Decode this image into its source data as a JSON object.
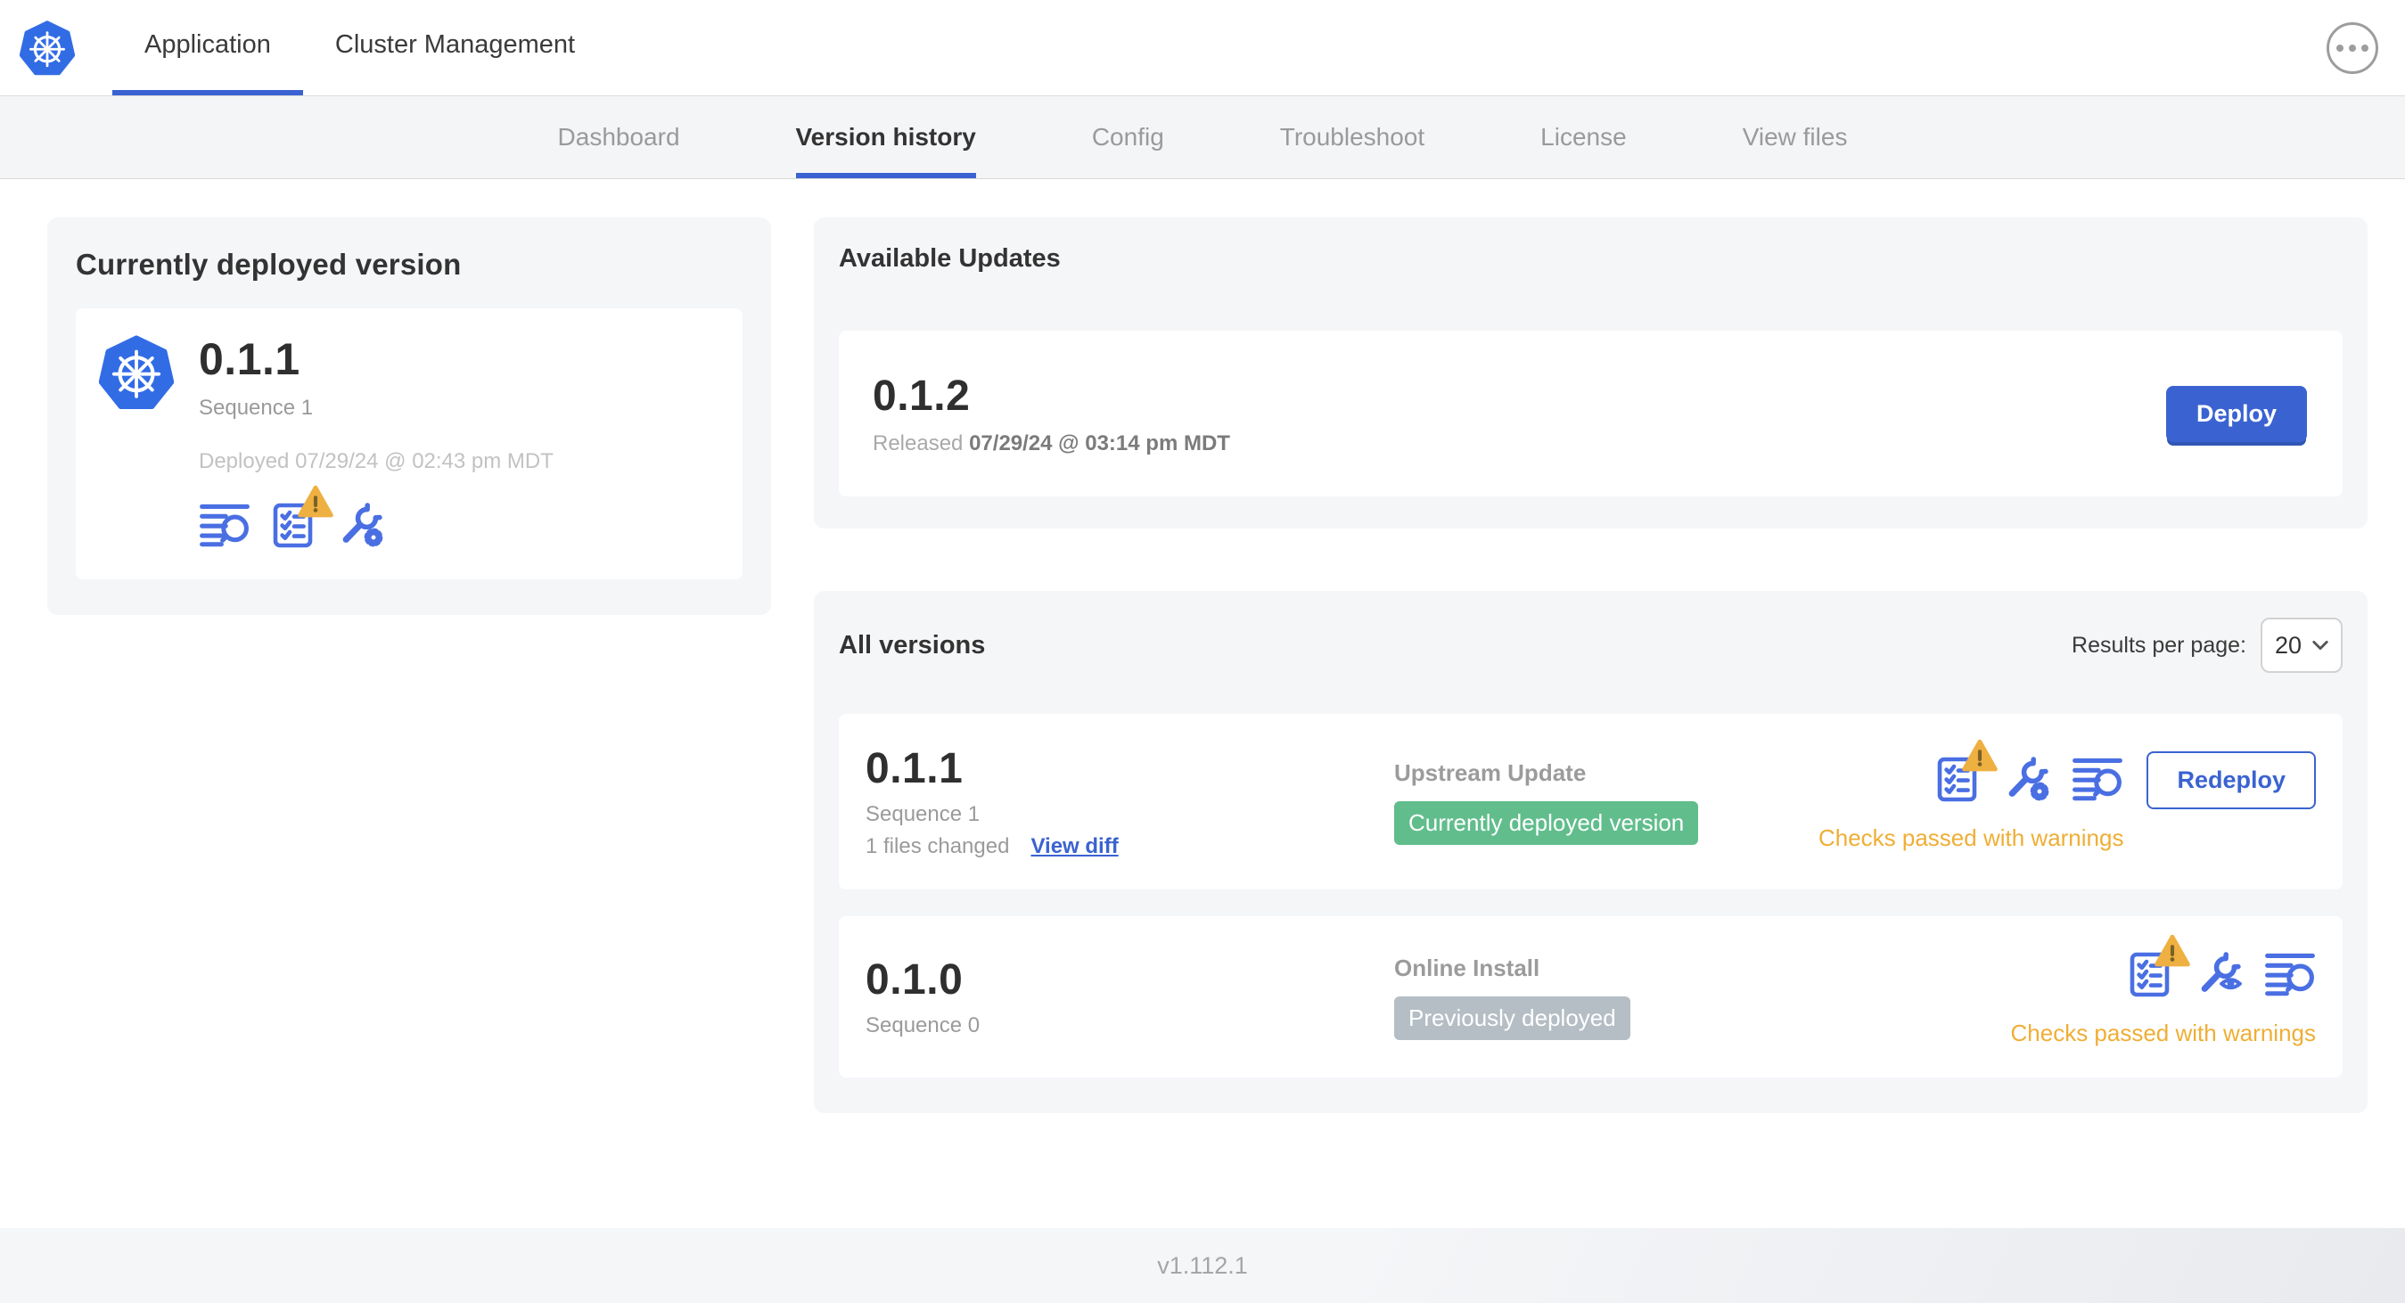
{
  "colors": {
    "accent": "#3a63d1",
    "icon-blue": "#4a6fe3",
    "green": "#61bd8c",
    "gray-badge": "#b4bec4",
    "warning": "#efae35",
    "k8s-blue": "#326ce5"
  },
  "header": {
    "tabs": [
      {
        "label": "Application"
      },
      {
        "label": "Cluster Management"
      }
    ]
  },
  "subnav": {
    "items": [
      "Dashboard",
      "Version history",
      "Config",
      "Troubleshoot",
      "License",
      "View files"
    ]
  },
  "current_version_card": {
    "title": "Currently deployed version",
    "version": "0.1.1",
    "sequence": "Sequence 1",
    "deployed_text": "Deployed 07/29/24 @ 02:43 pm MDT"
  },
  "available_updates": {
    "title": "Available Updates",
    "update": {
      "version": "0.1.2",
      "released_prefix": "Released",
      "released_date": "07/29/24 @ 03:14 pm MDT",
      "deploy_label": "Deploy"
    }
  },
  "all_versions": {
    "title": "All versions",
    "results_per_page_label": "Results per page:",
    "results_per_page_value": "20",
    "rows": [
      {
        "version": "0.1.1",
        "sequence": "Sequence 1",
        "files_changed": "1 files changed",
        "view_diff_label": "View diff",
        "source": "Upstream Update",
        "status_badge": "Currently deployed version",
        "checks_text": "Checks passed with warnings",
        "action_label": "Redeploy"
      },
      {
        "version": "0.1.0",
        "sequence": "Sequence 0",
        "source": "Online Install",
        "status_badge": "Previously deployed",
        "checks_text": "Checks passed with warnings"
      }
    ]
  },
  "footer": {
    "version": "v1.112.1"
  }
}
